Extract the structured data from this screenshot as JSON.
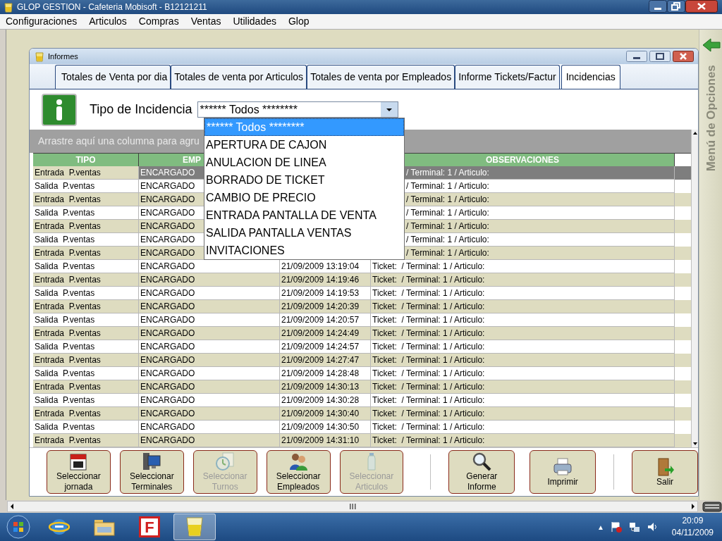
{
  "window": {
    "title": "GLOP GESTION - Cafeteria Mobisoft - B12121211"
  },
  "menu": [
    "Configuraciones",
    "Articulos",
    "Compras",
    "Ventas",
    "Utilidades",
    "Glop"
  ],
  "report_window": {
    "title": "Informes"
  },
  "tabs": [
    {
      "label": "Totales de Venta por dia",
      "selected": false
    },
    {
      "label": "Totales de venta por Articulos",
      "selected": false
    },
    {
      "label": "Totales de venta por Empleados",
      "selected": false
    },
    {
      "label": "Informe Tickets/Factur",
      "selected": false
    },
    {
      "label": "Incidencias",
      "selected": true
    }
  ],
  "filter": {
    "label": "Tipo de Incidencia",
    "value": "****** Todos ********",
    "expanded": true,
    "options": [
      {
        "label": "****** Todos ********",
        "selected": true
      },
      {
        "label": "APERTURA DE CAJON",
        "selected": false
      },
      {
        "label": "ANULACION DE LINEA",
        "selected": false
      },
      {
        "label": "BORRADO DE TICKET",
        "selected": false
      },
      {
        "label": "CAMBIO DE PRECIO",
        "selected": false
      },
      {
        "label": "ENTRADA PANTALLA DE VENTA",
        "selected": false
      },
      {
        "label": "SALIDA PANTALLA VENTAS",
        "selected": false
      },
      {
        "label": "INVITACIONES",
        "selected": false
      }
    ]
  },
  "group_hint": "Arrastre aquí una columna para agru",
  "table": {
    "header": {
      "tipo": "TIPO",
      "empleado": "EMP",
      "observaciones": "OBSERVACIONES"
    },
    "rows": [
      {
        "tipo": "Entrada  P.ventas",
        "empleado": "ENCARGADO",
        "observaciones": "/ Terminal: 1 / Articulo:",
        "selected": true
      },
      {
        "tipo": "Salida  P.ventas",
        "empleado": "ENCARGADO",
        "observaciones": "/ Terminal: 1 / Articulo:",
        "selected": false
      },
      {
        "tipo": "Entrada  P.ventas",
        "empleado": "ENCARGADO",
        "observaciones": "/ Terminal: 1 / Articulo:",
        "selected": false
      },
      {
        "tipo": "Salida  P.ventas",
        "empleado": "ENCARGADO",
        "observaciones": "/ Terminal: 1 / Articulo:",
        "selected": false
      },
      {
        "tipo": "Entrada  P.ventas",
        "empleado": "ENCARGADO",
        "observaciones": "/ Terminal: 1 / Articulo:",
        "selected": false
      },
      {
        "tipo": "Salida  P.ventas",
        "empleado": "ENCARGADO",
        "observaciones": "/ Terminal: 1 / Articulo:",
        "selected": false
      },
      {
        "tipo": "Entrada  P.ventas",
        "empleado": "ENCARGADO",
        "observaciones": "/ Terminal: 1 / Articulo:",
        "selected": false
      },
      {
        "tipo": "Salida  P.ventas",
        "empleado": "ENCARGADO",
        "fecha": "21/09/2009 13:19:04",
        "observaciones": "Ticket:  / Terminal: 1 / Articulo:",
        "selected": false
      },
      {
        "tipo": "Entrada  P.ventas",
        "empleado": "ENCARGADO",
        "fecha": "21/09/2009 14:19:46",
        "observaciones": "Ticket:  / Terminal: 1 / Articulo:",
        "selected": false
      },
      {
        "tipo": "Salida  P.ventas",
        "empleado": "ENCARGADO",
        "fecha": "21/09/2009 14:19:53",
        "observaciones": "Ticket:  / Terminal: 1 / Articulo:",
        "selected": false
      },
      {
        "tipo": "Entrada  P.ventas",
        "empleado": "ENCARGADO",
        "fecha": "21/09/2009 14:20:39",
        "observaciones": "Ticket:  / Terminal: 1 / Articulo:",
        "selected": false
      },
      {
        "tipo": "Salida  P.ventas",
        "empleado": "ENCARGADO",
        "fecha": "21/09/2009 14:20:57",
        "observaciones": "Ticket:  / Terminal: 1 / Articulo:",
        "selected": false
      },
      {
        "tipo": "Entrada  P.ventas",
        "empleado": "ENCARGADO",
        "fecha": "21/09/2009 14:24:49",
        "observaciones": "Ticket:  / Terminal: 1 / Articulo:",
        "selected": false
      },
      {
        "tipo": "Salida  P.ventas",
        "empleado": "ENCARGADO",
        "fecha": "21/09/2009 14:24:57",
        "observaciones": "Ticket:  / Terminal: 1 / Articulo:",
        "selected": false
      },
      {
        "tipo": "Entrada  P.ventas",
        "empleado": "ENCARGADO",
        "fecha": "21/09/2009 14:27:47",
        "observaciones": "Ticket:  / Terminal: 1 / Articulo:",
        "selected": false
      },
      {
        "tipo": "Salida  P.ventas",
        "empleado": "ENCARGADO",
        "fecha": "21/09/2009 14:28:48",
        "observaciones": "Ticket:  / Terminal: 1 / Articulo:",
        "selected": false
      },
      {
        "tipo": "Entrada  P.ventas",
        "empleado": "ENCARGADO",
        "fecha": "21/09/2009 14:30:13",
        "observaciones": "Ticket:  / Terminal: 1 / Articulo:",
        "selected": false
      },
      {
        "tipo": "Salida  P.ventas",
        "empleado": "ENCARGADO",
        "fecha": "21/09/2009 14:30:28",
        "observaciones": "Ticket:  / Terminal: 1 / Articulo:",
        "selected": false
      },
      {
        "tipo": "Entrada  P.ventas",
        "empleado": "ENCARGADO",
        "fecha": "21/09/2009 14:30:40",
        "observaciones": "Ticket:  / Terminal: 1 / Articulo:",
        "selected": false
      },
      {
        "tipo": "Salida  P.ventas",
        "empleado": "ENCARGADO",
        "fecha": "21/09/2009 14:30:50",
        "observaciones": "Ticket:  / Terminal: 1 / Articulo:",
        "selected": false
      },
      {
        "tipo": "Entrada  P.ventas",
        "empleado": "ENCARGADO",
        "fecha": "21/09/2009 14:31:10",
        "observaciones": "Ticket:  / Terminal: 1 / Articulo:",
        "selected": false
      }
    ]
  },
  "toolbar": [
    {
      "kind": "calendar",
      "label": "Seleccionar jornada",
      "disabled": false
    },
    {
      "kind": "monitor",
      "label": "Seleccionar Terminales",
      "disabled": false
    },
    {
      "kind": "clock",
      "label": "Seleccionar Turnos",
      "disabled": true
    },
    {
      "kind": "people",
      "label": "Seleccionar Empleados",
      "disabled": false
    },
    {
      "kind": "bottle",
      "label": "Seleccionar Articulos",
      "disabled": true
    },
    {
      "kind": "magnifier",
      "label": "Generar Informe",
      "disabled": false
    },
    {
      "kind": "printer",
      "label": "Imprimir",
      "disabled": false
    },
    {
      "kind": "door",
      "label": "Salir",
      "disabled": false
    }
  ],
  "side_panel": {
    "title": "Menú de Opciones"
  },
  "taskbar": {
    "apps": [
      {
        "kind": "browser",
        "selected": false
      },
      {
        "kind": "folder",
        "selected": false
      },
      {
        "kind": "letter",
        "label": "F",
        "selected": false
      },
      {
        "kind": "glass",
        "selected": true
      }
    ],
    "tray_toggle": "▲",
    "time": "20:09",
    "date": "04/11/2009"
  }
}
